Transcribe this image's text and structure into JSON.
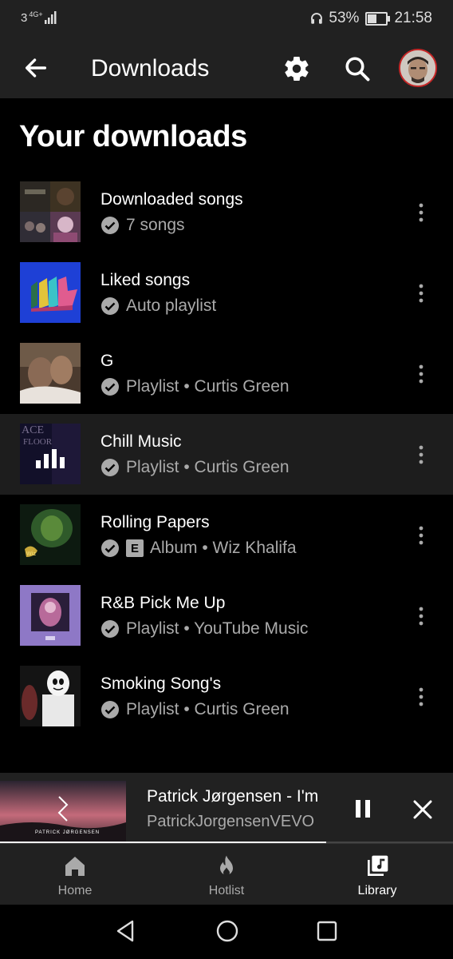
{
  "status": {
    "network": "3",
    "gen": "4G+",
    "battery": "53%",
    "battery_level": 0.53,
    "time": "21:58"
  },
  "appbar": {
    "title": "Downloads",
    "back_icon": "arrow-back-icon",
    "settings_icon": "gear-icon",
    "search_icon": "search-icon"
  },
  "heading": "Your downloads",
  "items": [
    {
      "title": "Downloaded songs",
      "subtitle": "7 songs",
      "explicit": false,
      "active": false
    },
    {
      "title": "Liked songs",
      "subtitle": "Auto playlist",
      "explicit": false,
      "active": false
    },
    {
      "title": "G",
      "subtitle": "Playlist • Curtis Green",
      "explicit": false,
      "active": false
    },
    {
      "title": "Chill Music",
      "subtitle": "Playlist • Curtis Green",
      "explicit": false,
      "active": true
    },
    {
      "title": "Rolling Papers",
      "subtitle": "Album • Wiz Khalifa",
      "explicit": true,
      "active": false
    },
    {
      "title": "R&B Pick Me Up",
      "subtitle": "Playlist • YouTube Music",
      "explicit": false,
      "active": false
    },
    {
      "title": "Smoking Song's",
      "subtitle": "Playlist • Curtis Green",
      "explicit": false,
      "active": false
    }
  ],
  "explicit_label": "E",
  "thumb_text": {
    "chill_line1": "ACE",
    "chill_line2": "FLOOR",
    "mini_brand": "PATRICK JØRGENSEN"
  },
  "miniplayer": {
    "title": "Patrick Jørgensen - I'm",
    "artist": "PatrickJorgensenVEVO",
    "progress": 0.72
  },
  "nav": {
    "home": "Home",
    "hotlist": "Hotlist",
    "library": "Library"
  }
}
